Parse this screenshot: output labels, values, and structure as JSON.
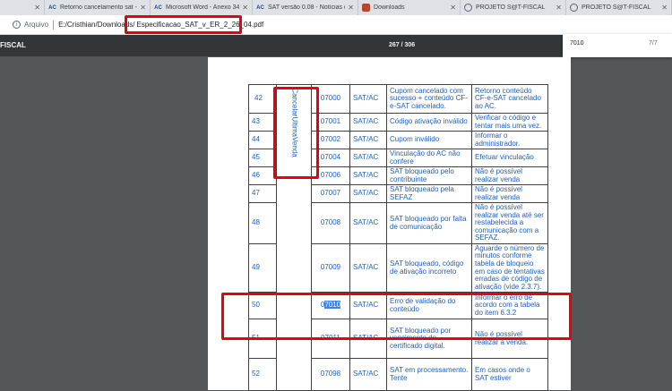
{
  "tabs": [
    {
      "label": "",
      "favicon": "",
      "partial": true
    },
    {
      "label": "Retorno cancelamento sat -",
      "favicon": "AC",
      "color": "#0d47a1"
    },
    {
      "label": "Microsoft Word - Anexo 34",
      "favicon": "AC",
      "color": "#0d47a1"
    },
    {
      "label": "SAT versão 0.08 - Notícias d",
      "favicon": "AC",
      "color": "#0d47a1"
    },
    {
      "label": "Downloads",
      "favicon": "",
      "color": "#b7472a"
    },
    {
      "label": "PROJETO S@T-FISCAL",
      "favicon": "",
      "color": "#5f6368"
    },
    {
      "label": "PROJETO S@T-FISCAL",
      "favicon": "",
      "color": "#5f6368"
    }
  ],
  "address": {
    "secure_label": "Arquivo",
    "path": "E:/Cristhian/Downloads/",
    "file": "Especificacao_SAT_v_ER_2_26_04.pdf"
  },
  "pdf": {
    "title": "FISCAL",
    "page_indicator": "267 / 306",
    "find_query": "7010",
    "find_count": "7/7"
  },
  "table": {
    "command": "CancelarUltimaVenda",
    "rows": [
      {
        "num": "42",
        "code": "07000",
        "src": "SAT/AC",
        "desc": "Cupom cancelado com sucesso + conteúdo CF-e-SAT cancelado.",
        "action": "Retorno conteúdo CF-e-SAT cancelado ao AC."
      },
      {
        "num": "43",
        "code": "07001",
        "src": "SAT/AC",
        "desc": "Código ativação inválido",
        "action": "Verificar o código e tentar mais uma vez."
      },
      {
        "num": "44",
        "code": "07002",
        "src": "SAT/AC",
        "desc": "Cupom inválido",
        "action": "Informar o administrador."
      },
      {
        "num": "45",
        "code": "07004",
        "src": "SAT/AC",
        "desc": "Vinculação do AC não confere",
        "action": "Efetuar vinculação"
      },
      {
        "num": "46",
        "code": "07006",
        "src": "SAT/AC",
        "desc": "SAT bloqueado pelo contribuinte",
        "action": "Não é possível realizar venda"
      },
      {
        "num": "47",
        "code": "07007",
        "src": "SAT/AC",
        "desc": "SAT bloqueado pela SEFAZ",
        "action": "Não é possível realizar venda"
      },
      {
        "num": "48",
        "code": "07008",
        "src": "SAT/AC",
        "desc": "SAT bloqueado por falta de comunicação",
        "action": "Não é possível realizar venda até ser restabelecida a comunicação com a SEFAZ."
      },
      {
        "num": "49",
        "code": "07009",
        "src": "SAT/AC",
        "desc": "SAT bloqueado, código de ativação incorreto",
        "action": "Aguarde o número de minutos conforme tabela de bloqueio em caso de tentativas erradas de código de ativação (vide 2.3.7)."
      },
      {
        "num": "50",
        "code_pre": "0",
        "code_hl": "7010",
        "src": "SAT/AC",
        "desc": "Erro de validação do conteúdo",
        "action": "Informar o erro de acordo com a tabela do item 6.3.2"
      },
      {
        "num": "51",
        "code": "07011",
        "src": "SAT/AC",
        "desc": "SAT bloqueado por vencimento do certificado digital.",
        "action": "Não é possível realizar a venda."
      },
      {
        "num": "52",
        "code": "07098",
        "src": "SAT/AC",
        "desc": "SAT em processamento. Tente",
        "action": "Em casos onde o SAT estiver"
      }
    ]
  }
}
